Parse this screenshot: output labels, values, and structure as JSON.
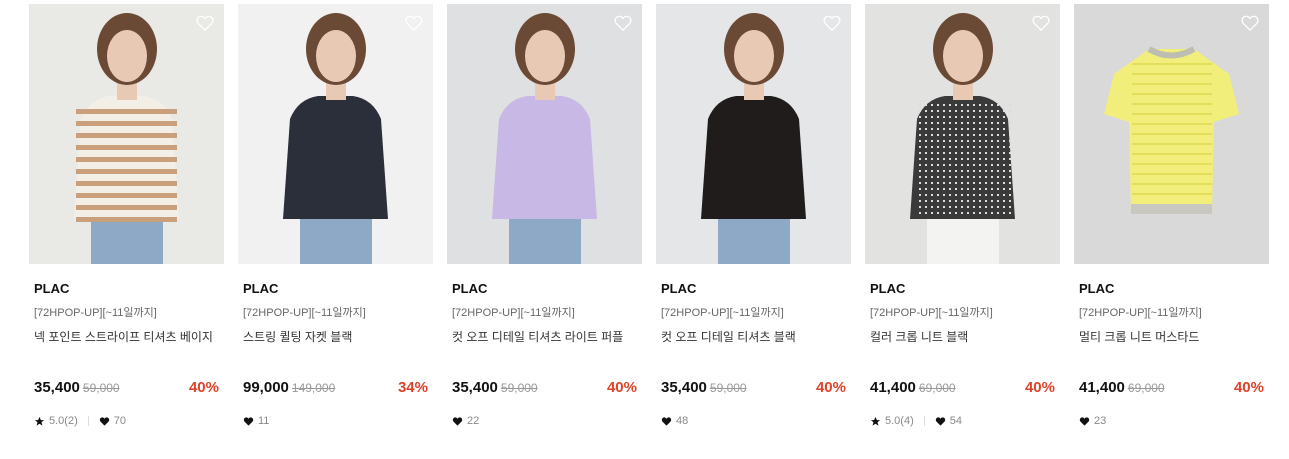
{
  "products": [
    {
      "brand": "PLAC",
      "tag": "[72HPOP-UP][~11일까지]",
      "name": "넥 포인트 스트라이프 티셔츠 베이지",
      "price": "35,400",
      "original_price": "59,000",
      "discount": "40%",
      "rating": "5.0(2)",
      "likes": "70",
      "bg": "#e9e9e6",
      "garment": "stripe"
    },
    {
      "brand": "PLAC",
      "tag": "[72HPOP-UP][~11일까지]",
      "name": "스트링 퀼팅 자켓 블랙",
      "price": "99,000",
      "original_price": "149,000",
      "discount": "34%",
      "rating": "",
      "likes": "11",
      "bg": "#f1f1f1",
      "garment": "jacket"
    },
    {
      "brand": "PLAC",
      "tag": "[72HPOP-UP][~11일까지]",
      "name": "컷 오프 디테일 티셔츠 라이트 퍼플",
      "price": "35,400",
      "original_price": "59,000",
      "discount": "40%",
      "rating": "",
      "likes": "22",
      "bg": "#dfe0e1",
      "garment": "purple"
    },
    {
      "brand": "PLAC",
      "tag": "[72HPOP-UP][~11일까지]",
      "name": "컷 오프 디테일 티셔츠 블랙",
      "price": "35,400",
      "original_price": "59,000",
      "discount": "40%",
      "rating": "",
      "likes": "48",
      "bg": "#e4e6e7",
      "garment": "black"
    },
    {
      "brand": "PLAC",
      "tag": "[72HPOP-UP][~11일까지]",
      "name": "컬러 크롭 니트 블랙",
      "price": "41,400",
      "original_price": "69,000",
      "discount": "40%",
      "rating": "5.0(4)",
      "likes": "54",
      "bg": "#e2e2e1",
      "garment": "knit"
    },
    {
      "brand": "PLAC",
      "tag": "[72HPOP-UP][~11일까지]",
      "name": "멀티 크롭 니트 머스타드",
      "price": "41,400",
      "original_price": "69,000",
      "discount": "40%",
      "rating": "",
      "likes": "23",
      "bg": "#d9d9d9",
      "garment": "yellow"
    }
  ]
}
